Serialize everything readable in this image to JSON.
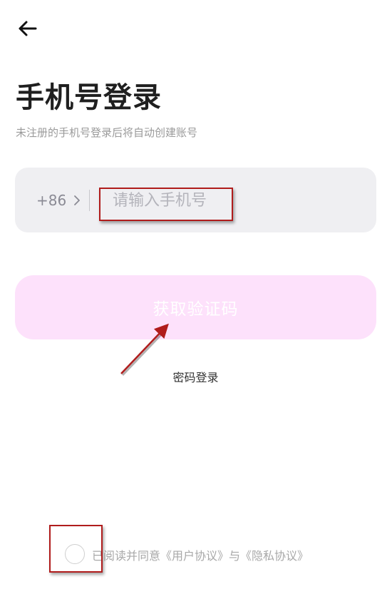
{
  "header": {
    "back_icon": "arrow-left-icon"
  },
  "title": "手机号登录",
  "subtitle": "未注册的手机号登录后将自动创建账号",
  "phone": {
    "country_code": "+86",
    "chevron_icon": "chevron-right-icon",
    "placeholder": "请输入手机号",
    "value": ""
  },
  "get_code_button": "获取验证码",
  "password_login": "密码登录",
  "agreement": {
    "prefix": "已阅读并同意",
    "user_agreement": "《用户协议》",
    "joiner": "与",
    "privacy_policy": "《隐私协议》"
  },
  "colors": {
    "button_bg": "#fde1fb",
    "input_bg": "#efeff2",
    "annotation": "#b01c1c"
  }
}
